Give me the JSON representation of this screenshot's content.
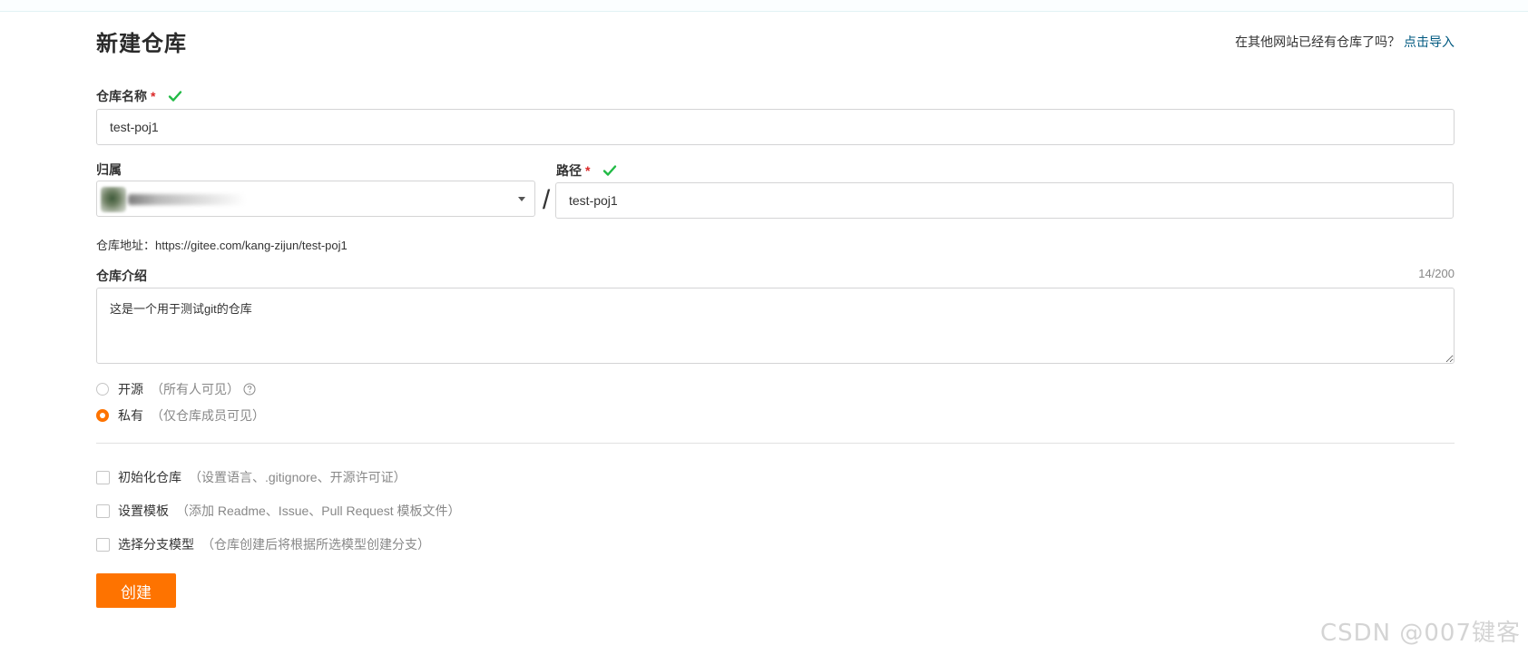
{
  "header": {
    "title": "新建仓库",
    "import_prompt": "在其他网站已经有仓库了吗？",
    "import_link": "点击导入"
  },
  "repo_name": {
    "label": "仓库名称",
    "required_mark": "*",
    "value": "test-poj1"
  },
  "owner": {
    "label": "归属"
  },
  "path": {
    "label": "路径",
    "required_mark": "*",
    "value": "test-poj1",
    "separator": "/"
  },
  "repo_url": {
    "text": "仓库地址：https://gitee.com/kang-zijun/test-poj1"
  },
  "description": {
    "label": "仓库介绍",
    "counter": "14/200",
    "value": "这是一个用于测试git的仓库"
  },
  "visibility": {
    "options": [
      {
        "label": "开源",
        "hint": "（所有人可见）",
        "selected": false
      },
      {
        "label": "私有",
        "hint": "（仅仓库成员可见）",
        "selected": true
      }
    ]
  },
  "extras": {
    "items": [
      {
        "label": "初始化仓库",
        "hint": "（设置语言、.gitignore、开源许可证）",
        "checked": false
      },
      {
        "label": "设置模板",
        "hint": "（添加 Readme、Issue、Pull Request 模板文件）",
        "checked": false
      },
      {
        "label": "选择分支模型",
        "hint": "（仓库创建后将根据所选模型创建分支）",
        "checked": false
      }
    ]
  },
  "actions": {
    "create_label": "创建"
  },
  "watermark": "CSDN @007键客",
  "colors": {
    "accent": "#fe7300",
    "link": "#005980",
    "valid": "#21ba45",
    "required": "#db2828"
  },
  "icons": {
    "valid": "check-icon",
    "help": "question-circle-icon",
    "dropdown": "caret-down-icon"
  }
}
